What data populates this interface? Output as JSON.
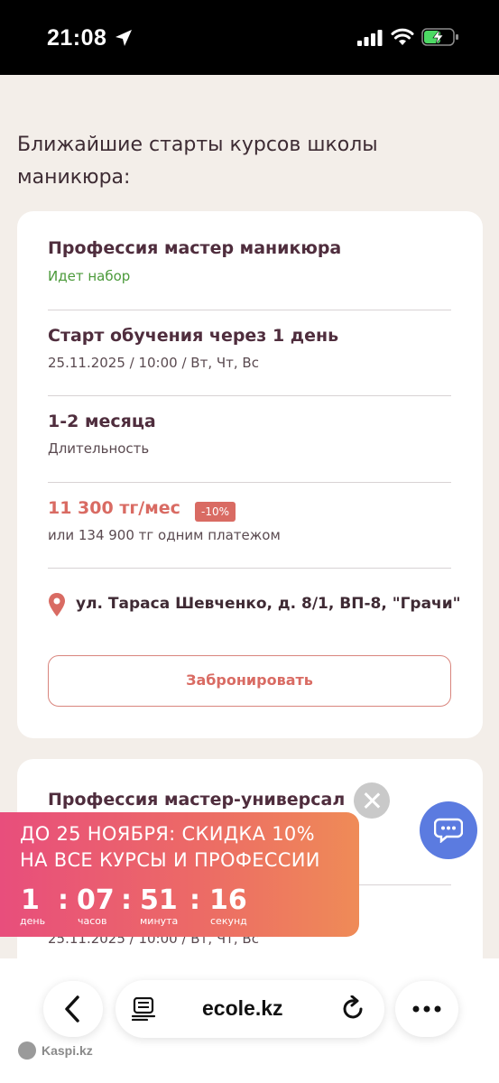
{
  "status_bar": {
    "time": "21:08"
  },
  "section": {
    "title": "Ближайшие старты курсов школы маникюра:"
  },
  "course_1": {
    "title": "Профессия мастер маникюра",
    "status": "Идет набор",
    "start_title": "Старт обучения через 1 день",
    "start_schedule": "25.11.2025 / 10:00 / Вт, Чт, Вс",
    "duration_value": "1-2 месяца",
    "duration_label": "Длительность",
    "price": "11 300 тг/мес",
    "discount": "-10%",
    "price_alt": "или 134 900 тг одним платежом",
    "address": "ул. Тараса Шевченко, д. 8/1, ВП-8, \"Грачи\"",
    "book_label": "Забронировать"
  },
  "course_2": {
    "title": "Профессия мастер-универсал",
    "start_schedule": "25.11.2025 / 10:00 / Вт, Чт, Вс"
  },
  "promo": {
    "line1": "ДО 25 НОЯБРЯ: СКИДКА 10%",
    "line2": "НА ВСЕ КУРСЫ И ПРОФЕССИИ",
    "timer": [
      {
        "value": "1",
        "label": "день"
      },
      {
        "value": "07",
        "label": "часов"
      },
      {
        "value": "51",
        "label": "минута"
      },
      {
        "value": "16",
        "label": "секунд"
      }
    ],
    "separator": ":"
  },
  "browser": {
    "url": "ecole.kz"
  },
  "watermark": {
    "text": "Kaspi.kz"
  },
  "colors": {
    "accent": "#d96b63",
    "status_green": "#4b9a3a",
    "chat": "#5b7be0"
  }
}
